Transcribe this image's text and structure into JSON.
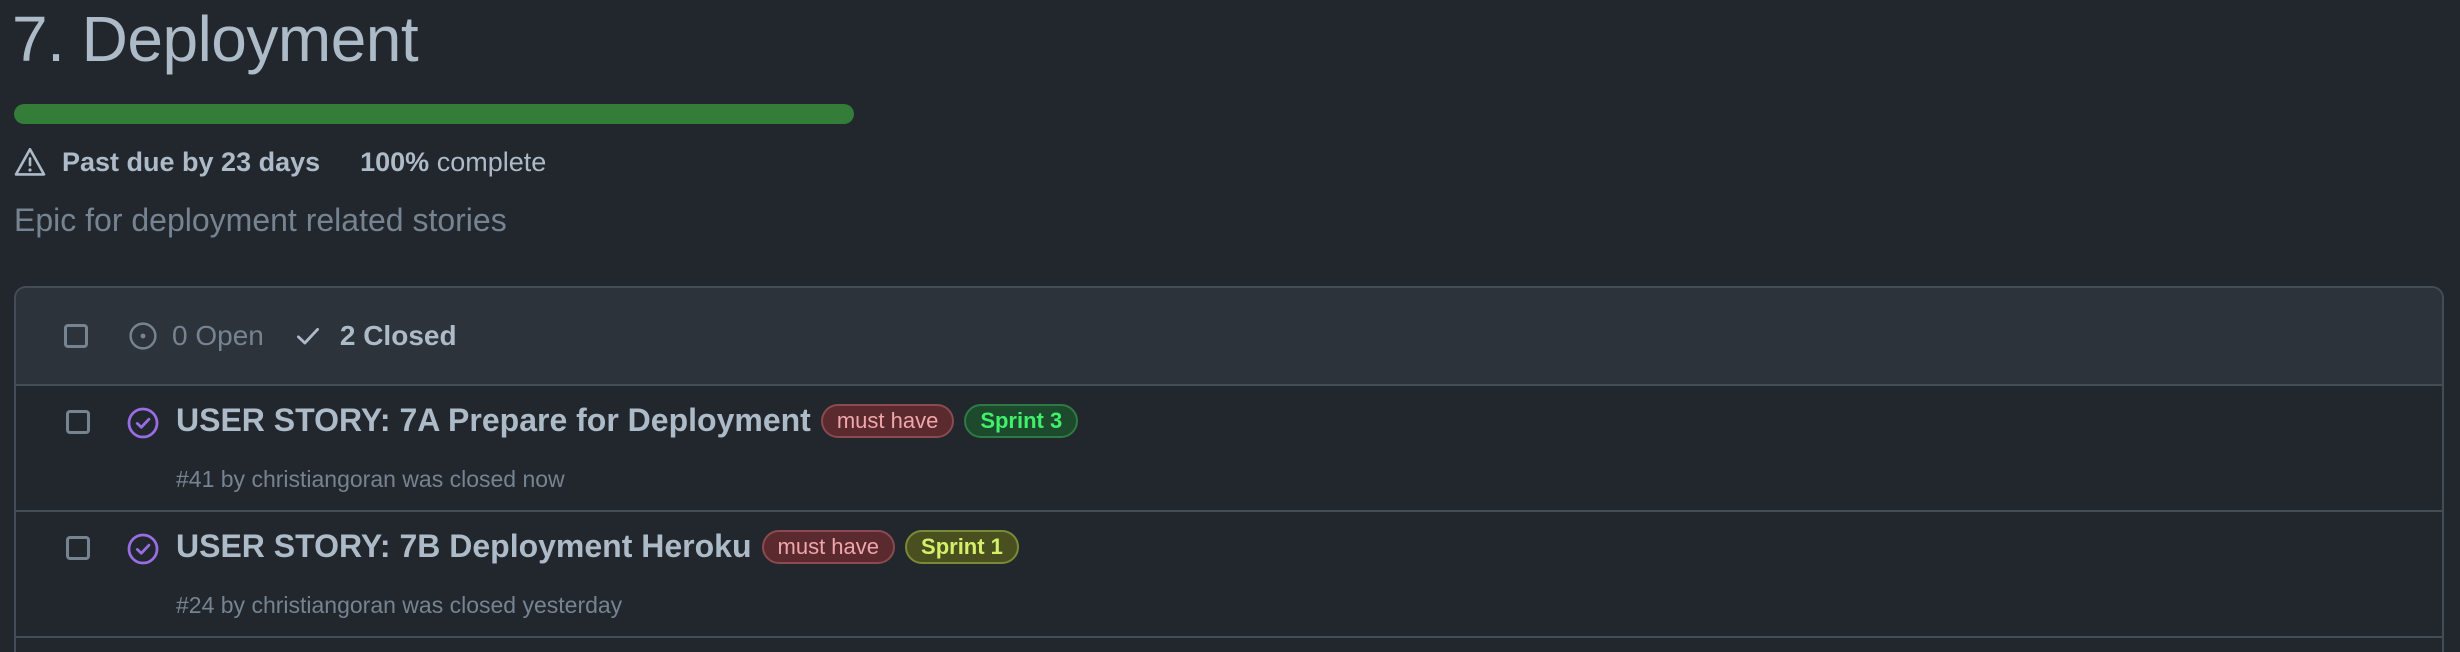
{
  "milestone": {
    "title": "7. Deployment",
    "progress_percent": 100,
    "due_status": "Past due by 23 days",
    "complete_percent": "100%",
    "complete_suffix": " complete",
    "description": "Epic for deployment related stories"
  },
  "filters": {
    "open_label": "0 Open",
    "closed_label": "2 Closed"
  },
  "issues": [
    {
      "title": "USER STORY: 7A Prepare for Deployment",
      "labels": [
        "must have",
        "Sprint 3"
      ],
      "meta": "#41 by christiangoran was closed now"
    },
    {
      "title": "USER STORY: 7B Deployment Heroku",
      "labels": [
        "must have",
        "Sprint 1"
      ],
      "meta": "#24 by christiangoran was closed yesterday"
    }
  ],
  "colors": {
    "background": "#22272e",
    "progress": "#347d39",
    "closed_icon": "#986ee2"
  },
  "icons": {
    "warning": "alert-triangle-icon",
    "open": "issue-open-icon",
    "closed": "check-icon",
    "issue_closed": "issue-closed-icon"
  }
}
